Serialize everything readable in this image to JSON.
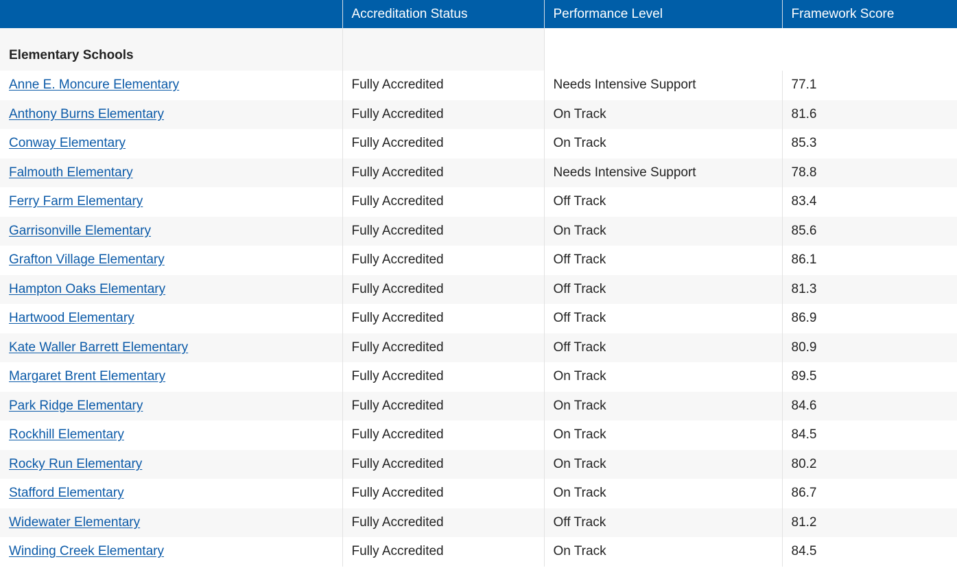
{
  "table": {
    "headers": [
      "",
      "Accreditation Status",
      "Performance Level",
      "Framework Score"
    ],
    "group_label": "Elementary Schools",
    "rows": [
      {
        "school": "Anne E. Moncure Elementary",
        "accreditation": "Fully Accredited",
        "performance": "Needs Intensive Support",
        "score": "77.1"
      },
      {
        "school": "Anthony Burns Elementary",
        "accreditation": "Fully Accredited",
        "performance": "On Track",
        "score": "81.6"
      },
      {
        "school": "Conway Elementary",
        "accreditation": "Fully Accredited",
        "performance": "On Track",
        "score": "85.3"
      },
      {
        "school": "Falmouth Elementary",
        "accreditation": "Fully Accredited",
        "performance": "Needs Intensive Support",
        "score": "78.8"
      },
      {
        "school": "Ferry Farm Elementary",
        "accreditation": "Fully Accredited",
        "performance": "Off Track",
        "score": "83.4"
      },
      {
        "school": "Garrisonville Elementary",
        "accreditation": "Fully Accredited",
        "performance": "On Track",
        "score": "85.6"
      },
      {
        "school": "Grafton Village Elementary",
        "accreditation": "Fully Accredited",
        "performance": "Off Track",
        "score": "86.1"
      },
      {
        "school": "Hampton Oaks Elementary",
        "accreditation": "Fully Accredited",
        "performance": "Off Track",
        "score": "81.3"
      },
      {
        "school": "Hartwood Elementary",
        "accreditation": "Fully Accredited",
        "performance": "Off Track",
        "score": "86.9"
      },
      {
        "school": "Kate Waller Barrett Elementary",
        "accreditation": "Fully Accredited",
        "performance": "Off Track",
        "score": "80.9"
      },
      {
        "school": "Margaret Brent Elementary",
        "accreditation": "Fully Accredited",
        "performance": "On Track",
        "score": "89.5"
      },
      {
        "school": "Park Ridge Elementary",
        "accreditation": "Fully Accredited",
        "performance": "On Track",
        "score": "84.6"
      },
      {
        "school": "Rockhill Elementary",
        "accreditation": "Fully Accredited",
        "performance": "On Track",
        "score": "84.5"
      },
      {
        "school": "Rocky Run Elementary",
        "accreditation": "Fully Accredited",
        "performance": "On Track",
        "score": "80.2"
      },
      {
        "school": "Stafford Elementary",
        "accreditation": "Fully Accredited",
        "performance": "On Track",
        "score": "86.7"
      },
      {
        "school": "Widewater Elementary",
        "accreditation": "Fully Accredited",
        "performance": "Off Track",
        "score": "81.2"
      },
      {
        "school": "Winding Creek Elementary",
        "accreditation": "Fully Accredited",
        "performance": "On Track",
        "score": "84.5"
      }
    ]
  },
  "colors": {
    "header_bg": "#005ea8",
    "link": "#0b5aa8",
    "row_alt": "#f7f7f7"
  }
}
